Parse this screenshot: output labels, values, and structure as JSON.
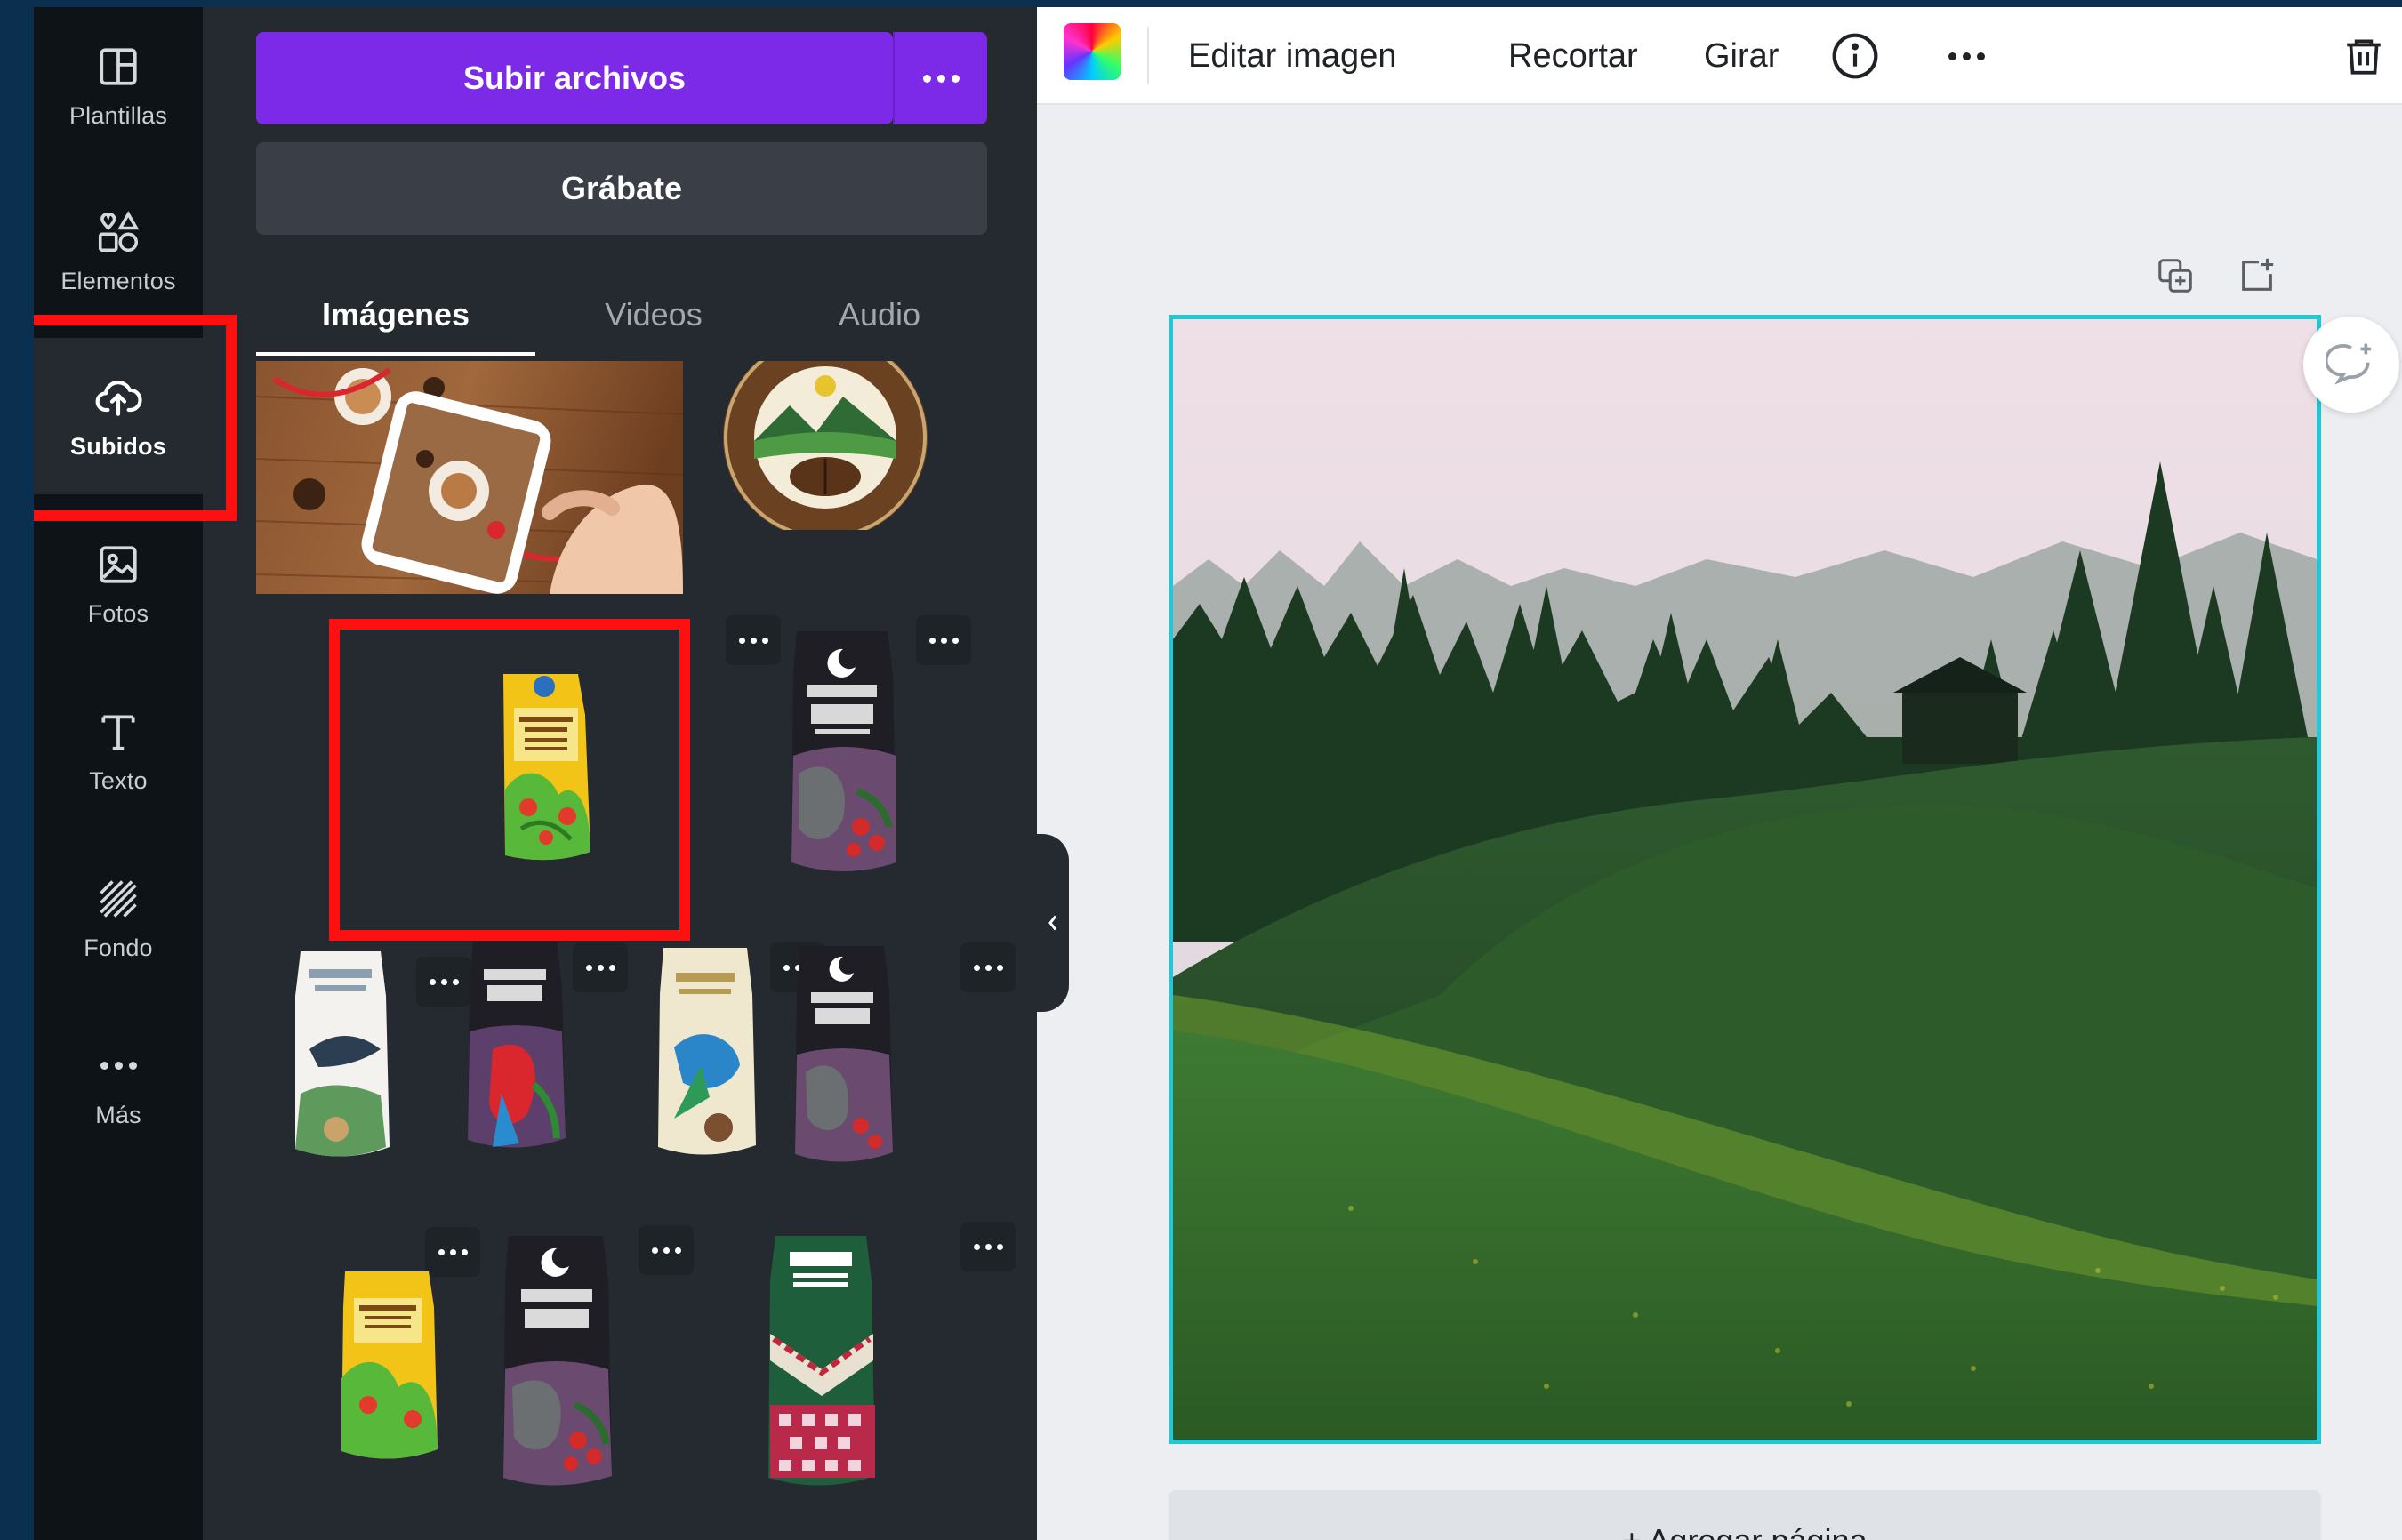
{
  "sidebar": {
    "items": [
      {
        "label": "Plantillas",
        "icon": "layout-icon"
      },
      {
        "label": "Elementos",
        "icon": "shapes-icon"
      },
      {
        "label": "Subidos",
        "icon": "cloud-upload-icon",
        "active": true
      },
      {
        "label": "Fotos",
        "icon": "image-icon"
      },
      {
        "label": "Texto",
        "icon": "text-icon"
      },
      {
        "label": "Fondo",
        "icon": "background-pattern-icon"
      },
      {
        "label": "Más",
        "icon": "more-icon"
      }
    ]
  },
  "panel": {
    "upload_label": "Subir archivos",
    "record_label": "Grábate",
    "tabs": [
      {
        "label": "Imágenes",
        "active": true
      },
      {
        "label": "Videos"
      },
      {
        "label": "Audio"
      }
    ]
  },
  "toolbar": {
    "edit_image": "Editar imagen",
    "crop": "Recortar",
    "rotate": "Girar"
  },
  "canvas": {
    "add_page": "+ Agregar página"
  },
  "colors": {
    "primary": "#7d2ae8",
    "rail_bg": "#0e1318",
    "panel_bg": "#252a31",
    "selection": "#21c8d6",
    "highlight": "#ff1010"
  }
}
